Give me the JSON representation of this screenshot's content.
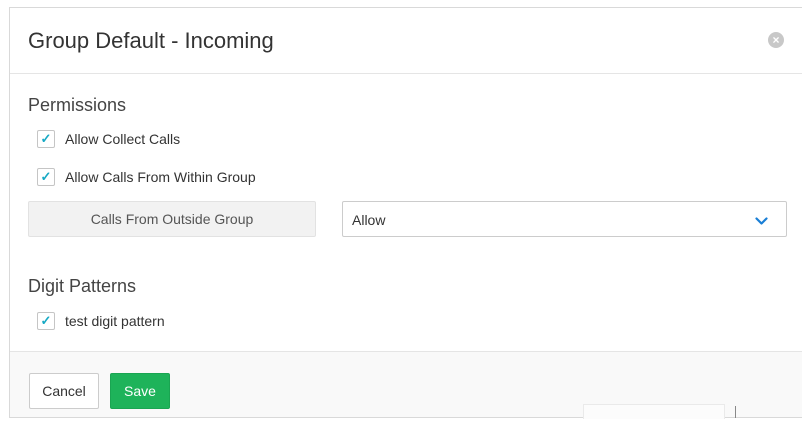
{
  "dialog": {
    "title": "Group Default - Incoming",
    "close_icon": "close-circle-icon"
  },
  "permissions": {
    "heading": "Permissions",
    "items": [
      {
        "label": "Allow Collect Calls",
        "checked": true
      },
      {
        "label": "Allow Calls From Within Group",
        "checked": true
      }
    ],
    "outside_group": {
      "label": "Calls From Outside Group",
      "selected": "Allow",
      "dropdown_icon": "chevron-down-icon"
    }
  },
  "digit_patterns": {
    "heading": "Digit Patterns",
    "items": [
      {
        "label": "test digit pattern",
        "checked": true
      }
    ]
  },
  "footer": {
    "cancel_label": "Cancel",
    "save_label": "Save"
  },
  "colors": {
    "accent_check": "#16a9c4",
    "save_button": "#1eb35a",
    "chevron": "#1a7fd6"
  }
}
